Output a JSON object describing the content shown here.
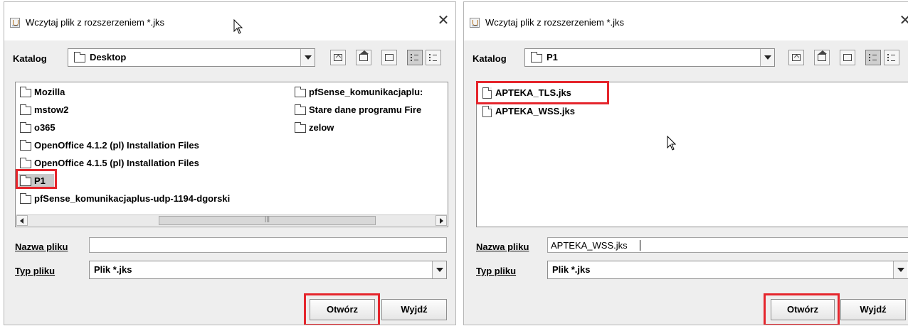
{
  "dialogs": [
    {
      "title": "Wczytaj plik z rozszerzeniem *.jks",
      "close_glyph": "✕",
      "katalog_label": "Katalog",
      "directory": "Desktop",
      "items": [
        {
          "name": "Mozilla",
          "type": "folder"
        },
        {
          "name": "mstow2",
          "type": "folder"
        },
        {
          "name": "o365",
          "type": "folder"
        },
        {
          "name": "OpenOffice 4.1.2 (pl) Installation Files",
          "type": "folder"
        },
        {
          "name": "OpenOffice 4.1.5 (pl) Installation Files",
          "type": "folder"
        },
        {
          "name": "P1",
          "type": "folder",
          "selected": true
        },
        {
          "name": "pfSense_komunikacjaplus-udp-1194-dgorski",
          "type": "folder"
        },
        {
          "name": "pfSense_komunikacjaplu:",
          "type": "folder"
        },
        {
          "name": "Stare dane programu Fire",
          "type": "folder"
        },
        {
          "name": "zelow",
          "type": "folder"
        }
      ],
      "filename_label": "Nazwa pliku",
      "filename_value": "",
      "filetype_label": "Typ pliku",
      "filetype_value": "Plik *.jks",
      "open_button": "Otwórz",
      "cancel_button": "Wyjdź"
    },
    {
      "title": "Wczytaj plik z rozszerzeniem *.jks",
      "close_glyph": "✕",
      "katalog_label": "Katalog",
      "directory": "P1",
      "items": [
        {
          "name": "APTEKA_TLS.jks",
          "type": "file",
          "highlighted": true
        },
        {
          "name": "APTEKA_WSS.jks",
          "type": "file"
        }
      ],
      "filename_label": "Nazwa pliku",
      "filename_value": "APTEKA_WSS.jks",
      "filetype_label": "Typ pliku",
      "filetype_value": "Plik *.jks",
      "open_button": "Otwórz",
      "cancel_button": "Wyjdź"
    }
  ],
  "colors": {
    "highlight": "#e5252c",
    "dialog_bg": "#eeeeee",
    "selection_bg": "#c9c9c9"
  },
  "icons": [
    "java-app-icon",
    "close-icon",
    "folder-icon",
    "file-icon",
    "up-folder-icon",
    "home-icon",
    "new-folder-icon",
    "list-view-icon",
    "details-view-icon",
    "chevron-down-icon",
    "mouse-cursor-icon"
  ]
}
